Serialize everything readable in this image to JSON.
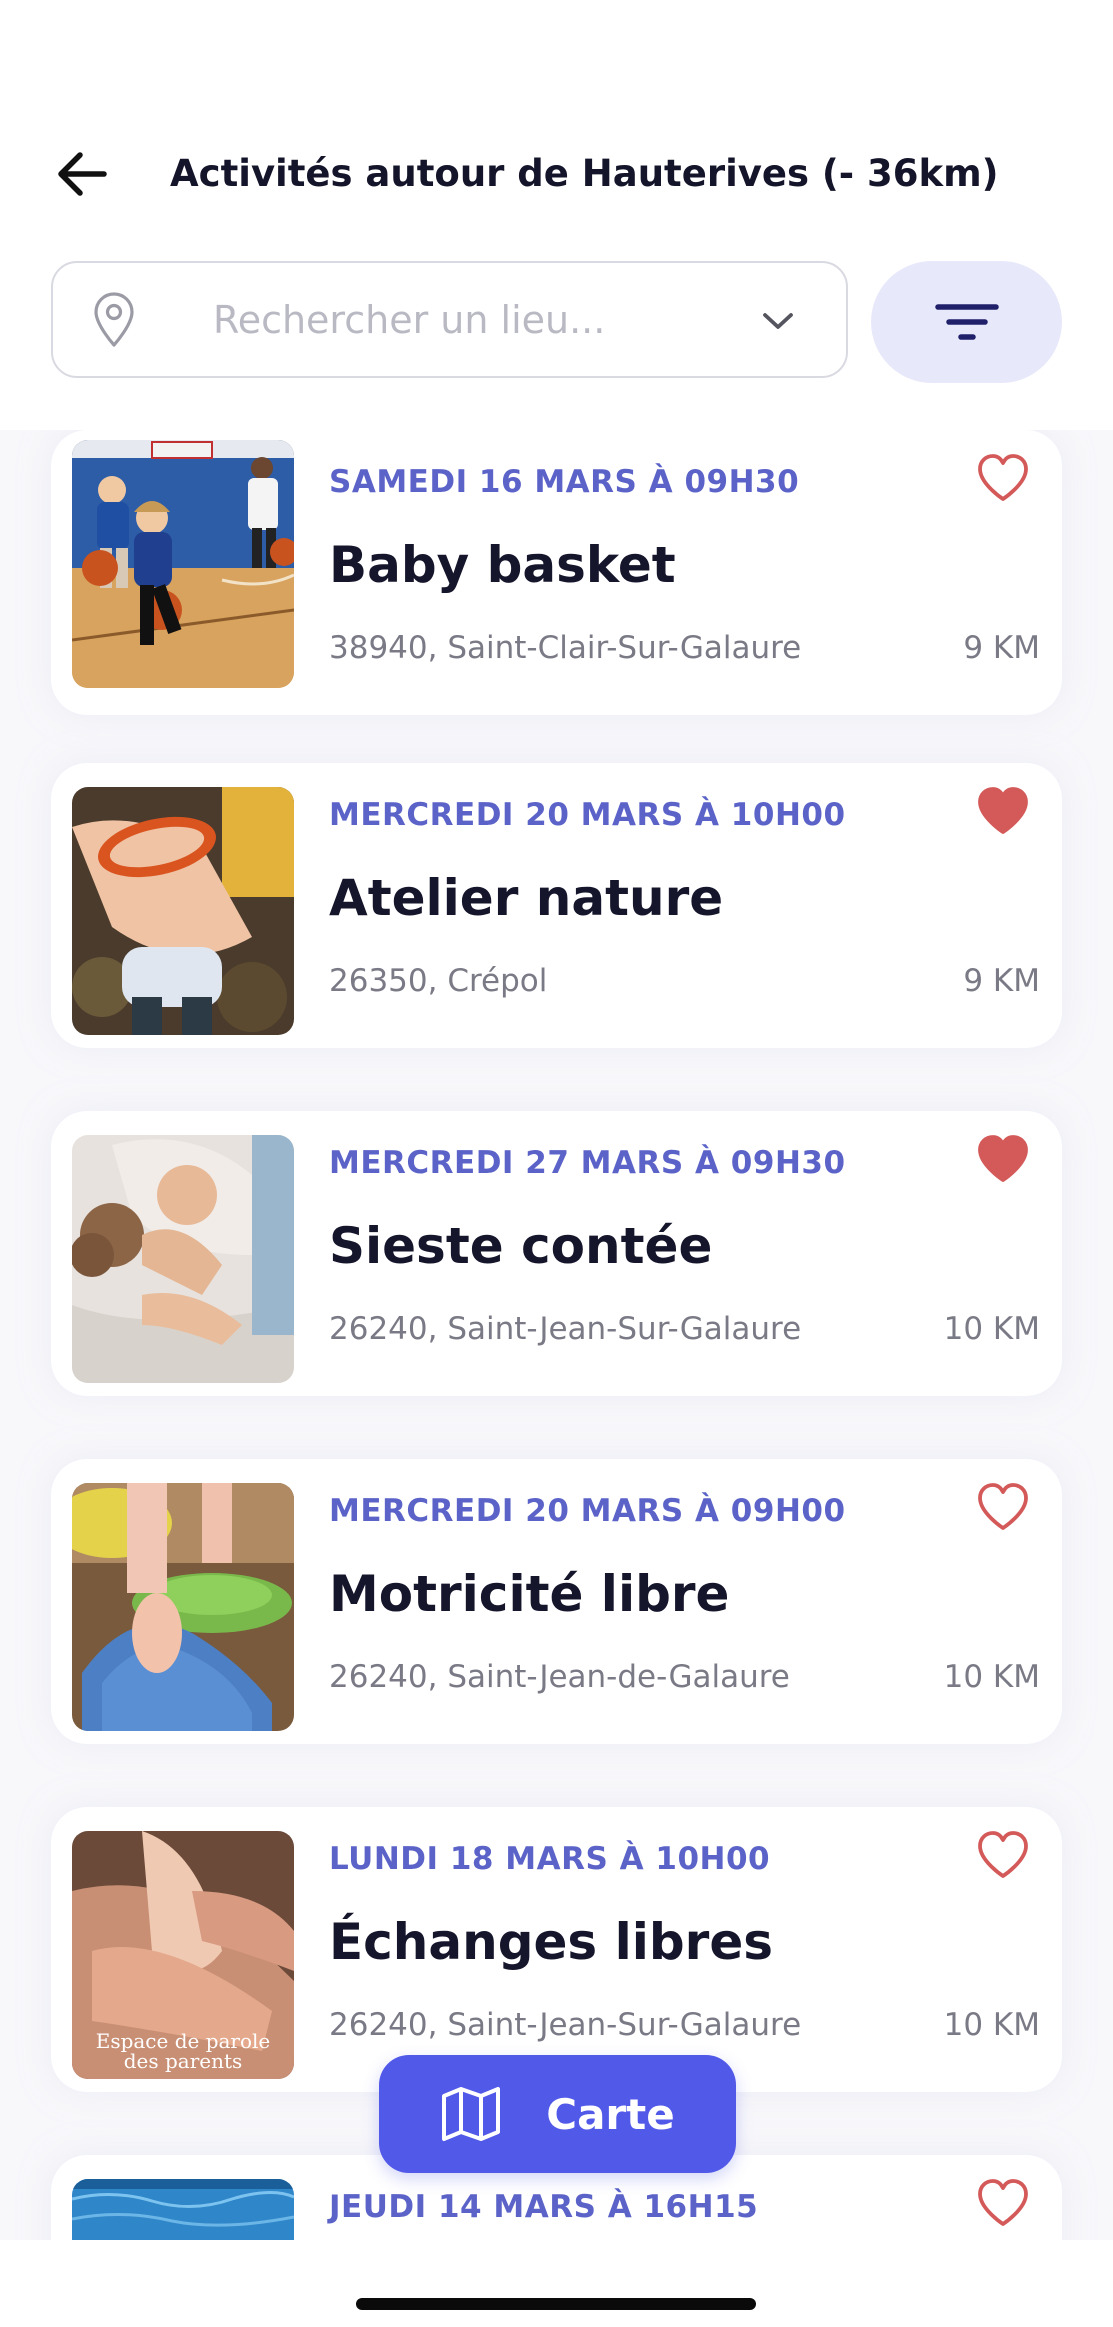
{
  "header": {
    "title": "Activités autour de Hauterives (- 36km)"
  },
  "search": {
    "placeholder": "Rechercher un lieu...",
    "value": ""
  },
  "activities": [
    {
      "date": "SAMEDI 16 MARS À 09H30",
      "title": "Baby basket",
      "location": "38940, Saint-Clair-Sur-Galaure",
      "distance": "9 KM",
      "favorite": false
    },
    {
      "date": "MERCREDI 20 MARS À 10H00",
      "title": "Atelier nature",
      "location": "26350, Crépol",
      "distance": "9 KM",
      "favorite": true
    },
    {
      "date": "MERCREDI 27 MARS À 09H30",
      "title": "Sieste contée",
      "location": "26240, Saint-Jean-Sur-Galaure",
      "distance": "10 KM",
      "favorite": true
    },
    {
      "date": "MERCREDI 20 MARS À 09H00",
      "title": "Motricité libre",
      "location": "26240, Saint-Jean-de-Galaure",
      "distance": "10 KM",
      "favorite": false
    },
    {
      "date": "LUNDI 18 MARS À 10H00",
      "title": "Échanges libres",
      "location": "26240, Saint-Jean-Sur-Galaure",
      "distance": "10 KM",
      "favorite": false,
      "image_caption_1": "Espace de parole",
      "image_caption_2": "des parents"
    },
    {
      "date": "JEUDI 14 MARS À 16H15",
      "title": "",
      "location": "",
      "distance": "",
      "favorite": false
    }
  ],
  "map_button": {
    "label": "Carte",
    "icon": "map-icon"
  },
  "icons": {
    "back": "arrow-left-icon",
    "location": "map-pin-icon",
    "dropdown": "chevron-down-icon",
    "filter": "filter-icon",
    "favorite": "heart-icon"
  },
  "colors": {
    "accent": "#5159e8",
    "date_text": "#5b63c8",
    "heart": "#d45a5a",
    "filter_bg": "#e8e8fb"
  }
}
